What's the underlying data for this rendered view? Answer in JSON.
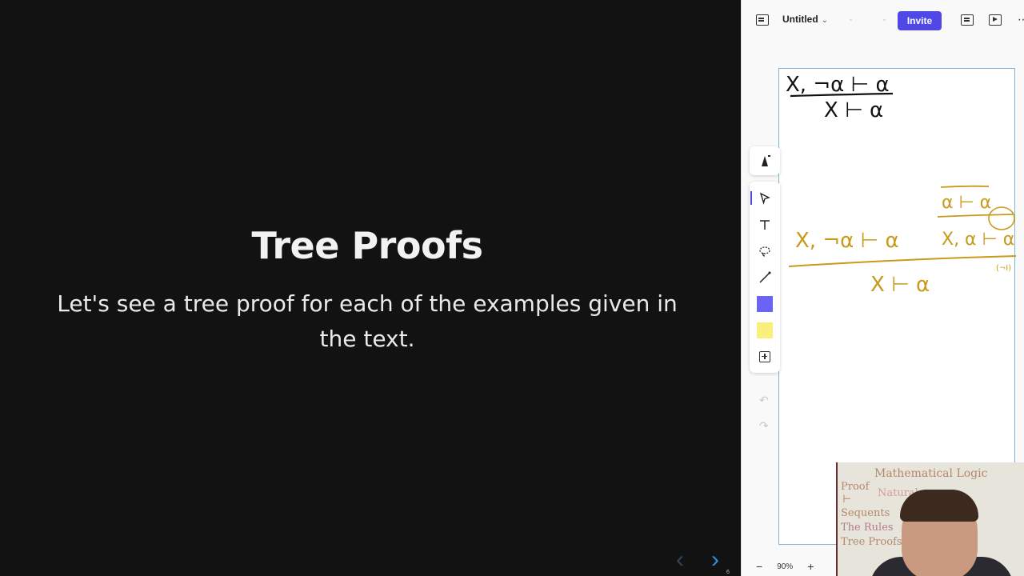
{
  "slide": {
    "title": "Tree Proofs",
    "body": "Let's see a tree proof for each of the examples given in the text.",
    "prev_icon": "chevron-left-icon",
    "next_icon": "chevron-right-icon",
    "page_number": "6"
  },
  "whiteboard": {
    "doc_title": "Untitled",
    "invite_label": "Invite",
    "zoom_level": "90%",
    "zoom_out": "−",
    "zoom_in": "+",
    "accent_color": "#4f47e6",
    "handwriting": {
      "top_premise": "X, ¬α ⊢ α",
      "top_conclusion": "X ⊢ α",
      "left_premise": "X, ¬α ⊢ α",
      "right_upper": "α ⊢ α",
      "right_lower": "X, α ⊢ α",
      "rule_tag": "(¬I)",
      "bottom_conclusion": "X ⊢ α"
    },
    "tools": [
      "pen-icon",
      "select-arrow-icon",
      "text-icon",
      "lasso-icon",
      "line-icon",
      "shape-swatch",
      "sticky-note-swatch",
      "add-icon"
    ],
    "colors": {
      "ink_black": "#111111",
      "ink_gold": "#c99a1a",
      "shape": "#6c63f2",
      "sticky": "#f8f07a"
    }
  },
  "webcam": {
    "board_lines": [
      "Mathematical Logic",
      "Proof",
      "⊢",
      "Sequents",
      "The Rules",
      "Tree Proofs"
    ],
    "board_word": "Natural"
  }
}
